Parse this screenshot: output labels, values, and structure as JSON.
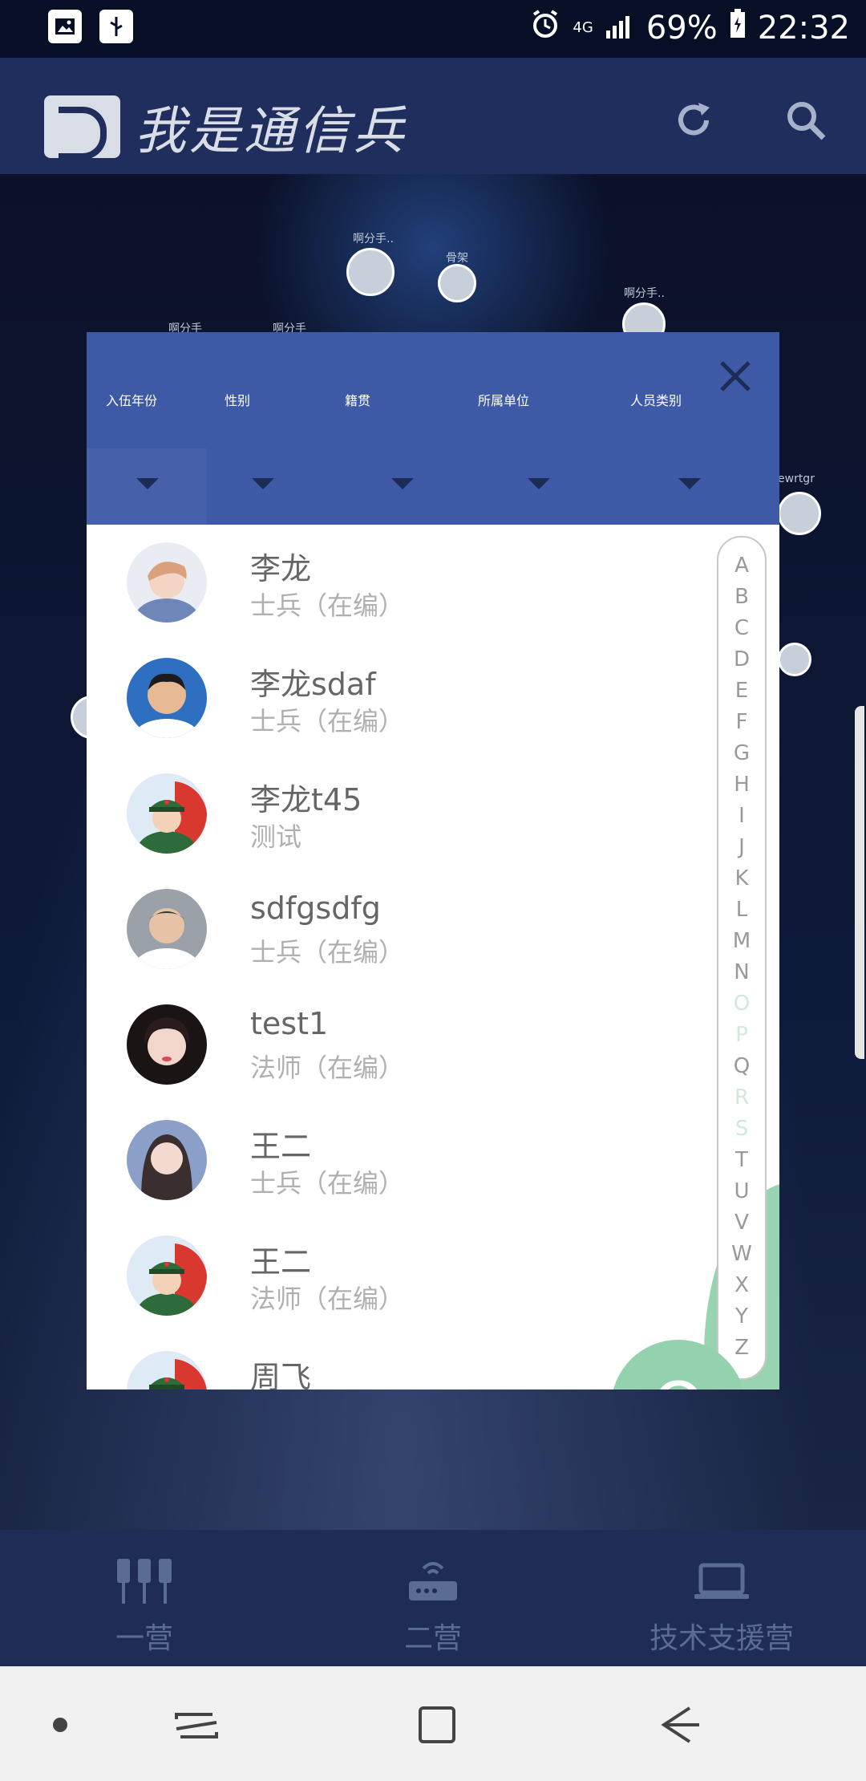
{
  "status_bar": {
    "network": "4G",
    "battery": "69%",
    "time": "22:32"
  },
  "header": {
    "app_title": "我是通信兵"
  },
  "filters": [
    {
      "label": "入伍年份"
    },
    {
      "label": "性别"
    },
    {
      "label": "籍贯"
    },
    {
      "label": "所属单位"
    },
    {
      "label": "人员类别"
    }
  ],
  "contacts": [
    {
      "name": "李龙",
      "role": "士兵（在编）"
    },
    {
      "name": "李龙sdaf",
      "role": "士兵（在编）"
    },
    {
      "name": "李龙t45",
      "role": "测试"
    },
    {
      "name": "sdfgsdfg",
      "role": "士兵（在编）"
    },
    {
      "name": "test1",
      "role": "法师（在编）"
    },
    {
      "name": "王二",
      "role": "士兵（在编）"
    },
    {
      "name": "王二",
      "role": "法师（在编）"
    },
    {
      "name": "周飞",
      "role": ""
    }
  ],
  "alphabet": [
    "A",
    "B",
    "C",
    "D",
    "E",
    "F",
    "G",
    "H",
    "I",
    "J",
    "K",
    "L",
    "M",
    "N",
    "O",
    "P",
    "Q",
    "R",
    "S",
    "T",
    "U",
    "V",
    "W",
    "X",
    "Y",
    "Z"
  ],
  "alphabet_selected": "Q",
  "bubble_letter": "Q",
  "bottom_tabs": [
    {
      "label": "一营",
      "icon": "plugs-icon"
    },
    {
      "label": "二营",
      "icon": "router-icon"
    },
    {
      "label": "技术支援营",
      "icon": "laptop-icon"
    }
  ],
  "background_labels": [
    "啊分手..",
    "骨架",
    "啊分手..",
    "啊分手",
    "啊分手",
    "ewrtgr"
  ],
  "colors": {
    "header_bg": "#1f2e5d",
    "filter_bar": "#3e5aa6",
    "accent_green": "#94d1ad",
    "tab_bar": "#1e2c56"
  }
}
